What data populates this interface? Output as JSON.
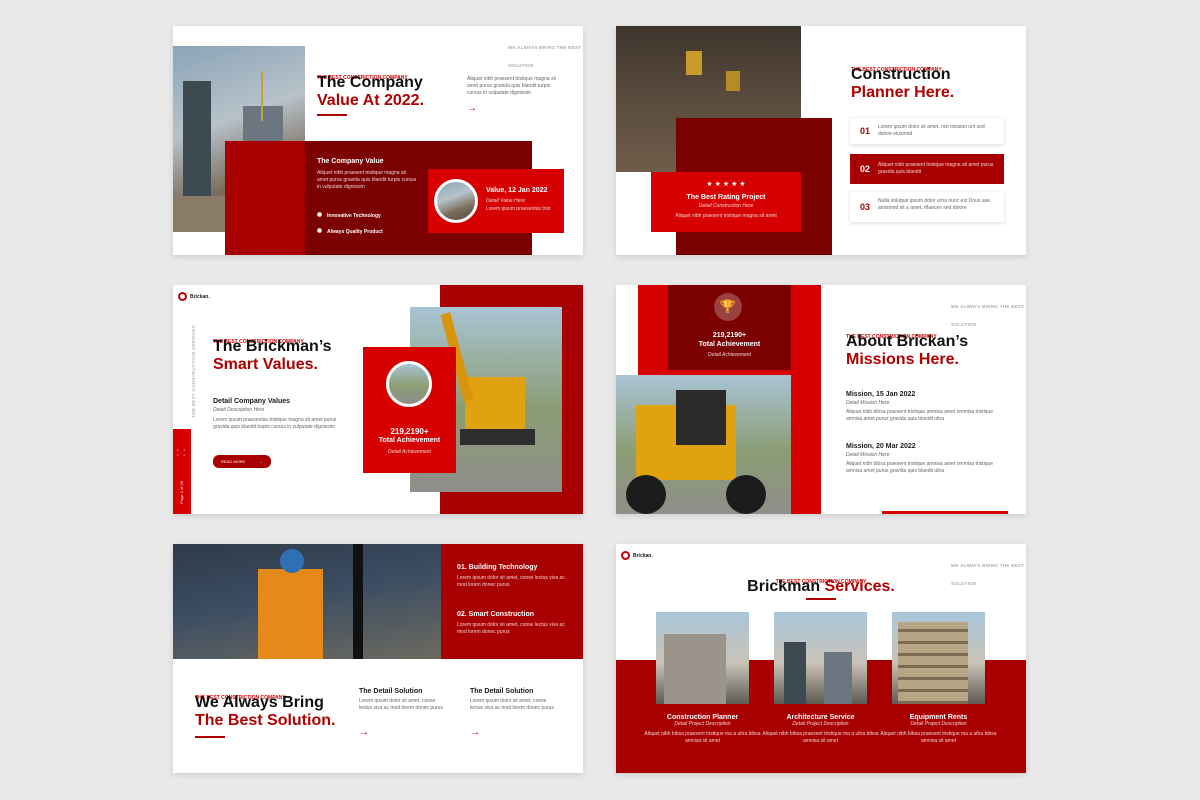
{
  "colors": {
    "primary_red": "#a80000",
    "dark_red": "#7b0000",
    "bright_red": "#d60000",
    "background": "#e9e9e9"
  },
  "slide1": {
    "kicker": "THE BEST CONSTRICTION COMPANY",
    "title_line1": "The Company",
    "title_line2": "Value At 2022.",
    "intro": "Aliquet nibh praesent tristique magna sit amet purus gravida quis blandit turpis cursus in vulputate dignissim",
    "top_right_text": "WE ALWAYS BRING THE BEST SOLUTION",
    "panel_title": "The Company Value",
    "panel_text": "Aliquet nibh praesent tristique magna sit amet purus gravida quis blandit turpis cursus in vulputate dignissim",
    "bullets": [
      "Innovative Technology",
      "Always Quality Product"
    ],
    "card_title": "Value, 12 Jan 2022",
    "card_sub": "Detail Value Here",
    "card_text": "Lorem ipsum praesentas trist"
  },
  "slide2": {
    "kicker": "THE BEST CONSTRICTION COMPANY",
    "title_line1": "Construction",
    "title_line2": "Planner Here.",
    "stars": "★ ★ ★ ★ ★",
    "rating_title": "The Best Rating Project",
    "rating_sub": "Detail Construction Here",
    "rating_text": "Aliquet nibh praesent tristique magna sit amet",
    "items": [
      {
        "num": "01",
        "text": "Lorem ipsum dolor sit amet, nisl mission unt sed dolore eiusmod"
      },
      {
        "num": "02",
        "text": "Aliquet nibh praesent tristique magna sit amet purus gravida quis blandit"
      },
      {
        "num": "03",
        "text": "Nulla volutpat ipsum dolor urna nunc est Dous sae amismod sit a amet, Maecen sed dolore"
      }
    ]
  },
  "slide3": {
    "logo": "Brickan.",
    "side_vertical": "THE BEST CONSTRUCTION SERVICES",
    "side_tab": "Page 1 of 20",
    "kicker": "THE BEST CONSTRICTION COMPANY",
    "title_line1": "The Brickman’s",
    "title_line2": "Smart Values.",
    "detail_title": "Detail Company Values",
    "detail_sub": "Detail Description Here",
    "detail_text": "Lorem ipsum praesentas tristique magna sit amet purus gravida quis blandit turpis cursus in vulputate dignissim",
    "button": "READ MORE",
    "stat_value": "219,2190+",
    "stat_label": "Total Achievement",
    "stat_sub": "Detail Achievement"
  },
  "slide4": {
    "top_right_text": "WE ALWAYS BRING THE BEST SOLUTION",
    "stat_value": "219,2190+",
    "stat_label": "Total Achievement",
    "stat_sub": "Detail Achievement",
    "kicker": "THE BEST CONSTRICTION COMPANY",
    "title_line1": "About Brickan’s",
    "title_line2": "Missions Here.",
    "missions": [
      {
        "title": "Mission, 15 Jan 2022",
        "sub": "Detail Mission Here",
        "text": "Aliquet nibh bibsa praesent tristique amnisa amet ommisa tristique amnisa amet purus gravida quis blandit ultra"
      },
      {
        "title": "Mission, 20 Mar 2022",
        "sub": "Detail Mission Here",
        "text": "Aliquet nibh bibsa praesent tristique amnisa amet ommisa tristique amnisa amet purus gravida quis blandit ultra"
      }
    ]
  },
  "slide5": {
    "items": [
      {
        "title": "01. Building Technology",
        "text": "Lorem ipsum dolor sit amet, conse lectus viva ac mod lorem donec purus"
      },
      {
        "title": "02. Smart Construction",
        "text": "Lorem ipsum dolor sit amet, conse lectus viva ac mod lorem donec purus"
      }
    ],
    "kicker": "THE BEST CONSTRICTION COMPANY",
    "title_line1": "We Always Bring",
    "title_line2": "The Best Solution.",
    "cols": [
      {
        "title": "The Detail Solution",
        "text": "Lorem ipsum dolor sit amet, conse lectus viva ac mod lorem donec purus"
      },
      {
        "title": "The Detail Solution",
        "text": "Lorem ipsum dolor sit amet, conse lectus viva ac mod lorem donec purus"
      }
    ]
  },
  "slide6": {
    "logo": "Brickan.",
    "top_right_text": "WE ALWAYS BRING THE BEST SOLUTION",
    "kicker": "THE BEST CONSTRICTION COMPANY",
    "title_part1": "Brickman",
    "title_part2": "Services.",
    "services": [
      {
        "title": "Construction Planner",
        "sub": "Detail Project Description",
        "text": "Aliquet nibh bibsa praesent tristique ma a ultra bibsa amnisa sit amet"
      },
      {
        "title": "Architecture Service",
        "sub": "Detail Project Description",
        "text": "Aliquet nibh bibsa praesent tristique ma a ultra bibsa amnisa sit amet"
      },
      {
        "title": "Equipment Rents",
        "sub": "Detail Project Description",
        "text": "Aliquet nibh bibsa praesent tristique ma a ultra bibsa amnisa sit amet"
      }
    ]
  }
}
